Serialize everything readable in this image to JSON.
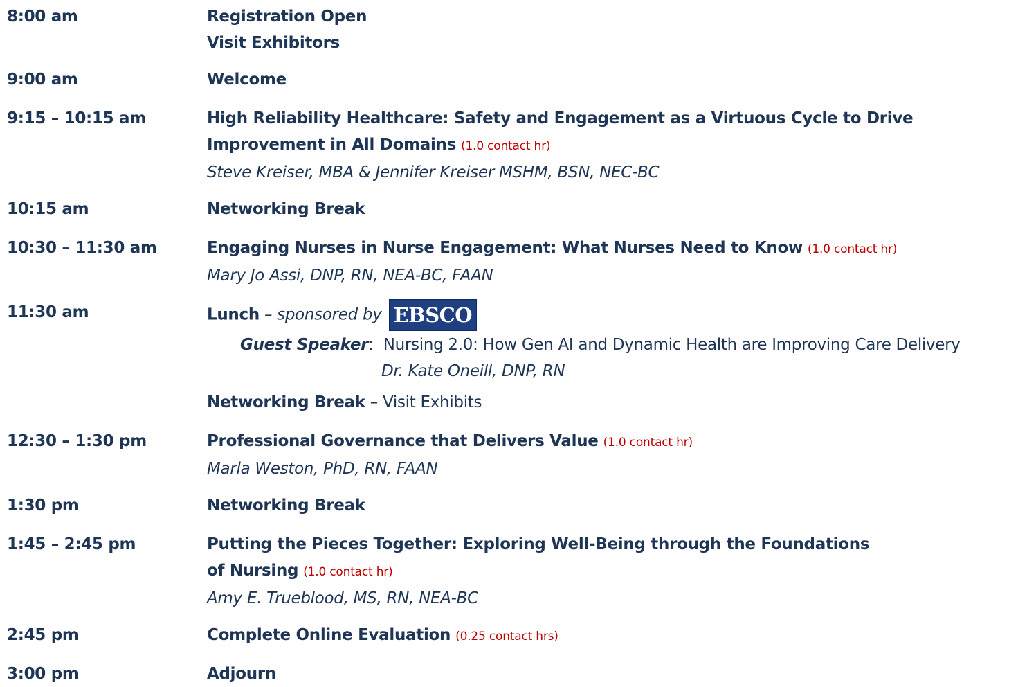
{
  "agenda": [
    {
      "time": "8:00 am",
      "line1": "Registration Open",
      "line2": "Visit Exhibitors"
    },
    {
      "time": "9:00 am",
      "title": "Welcome"
    },
    {
      "time": "9:15 – 10:15 am",
      "title_a": "High Reliability Healthcare: Safety and Engagement as a Virtuous Cycle to Drive",
      "title_b": "Improvement in All Domains",
      "credit": "(1.0 contact hr)",
      "speaker": "Steve Kreiser, MBA & Jennifer Kreiser MSHM, BSN, NEC-BC"
    },
    {
      "time": "10:15 am",
      "title": "Networking Break"
    },
    {
      "time": "10:30 – 11:30 am",
      "title": "Engaging Nurses in Nurse Engagement: What Nurses Need to Know",
      "credit": "(1.0 contact hr)",
      "speaker": "Mary Jo Assi, DNP, RN, NEA-BC, FAAN"
    },
    {
      "time": "11:30 am",
      "title": "Lunch",
      "sponsor_text": "– sponsored by",
      "sponsor_logo": "EBSCO"
    },
    {
      "time": "12:30 – 1:30 pm",
      "title": "Professional Governance that Delivers Value",
      "credit": "(1.0 contact hr)",
      "speaker": "Marla Weston, PhD, RN, FAAN"
    },
    {
      "time": "1:30 pm",
      "title": "Networking Break"
    },
    {
      "time": "1:45 – 2:45 pm",
      "title_a": "Putting the Pieces Together: Exploring Well-Being through the Foundations",
      "title_b": "of Nursing",
      "credit": "(1.0 contact hr)",
      "speaker": "Amy E. Trueblood, MS, RN, NEA-BC"
    },
    {
      "time": "2:45 pm",
      "title": "Complete Online Evaluation",
      "credit": "(0.25 contact hrs)"
    },
    {
      "time": "3:00 pm",
      "title": "Adjourn"
    }
  ],
  "lunch_guest": {
    "label": "Guest Speaker",
    "colon": ":",
    "talk": "Nursing 2.0:  How Gen AI and Dynamic Health are Improving Care Delivery",
    "speaker": "Dr. Kate Oneill, DNP, RN"
  },
  "lunch_break": {
    "title": "Networking Break",
    "detail": "– Visit Exhibits"
  },
  "colors": {
    "text": "#1f3556",
    "credit": "#c00000",
    "logo_bg": "#1f3f80"
  }
}
